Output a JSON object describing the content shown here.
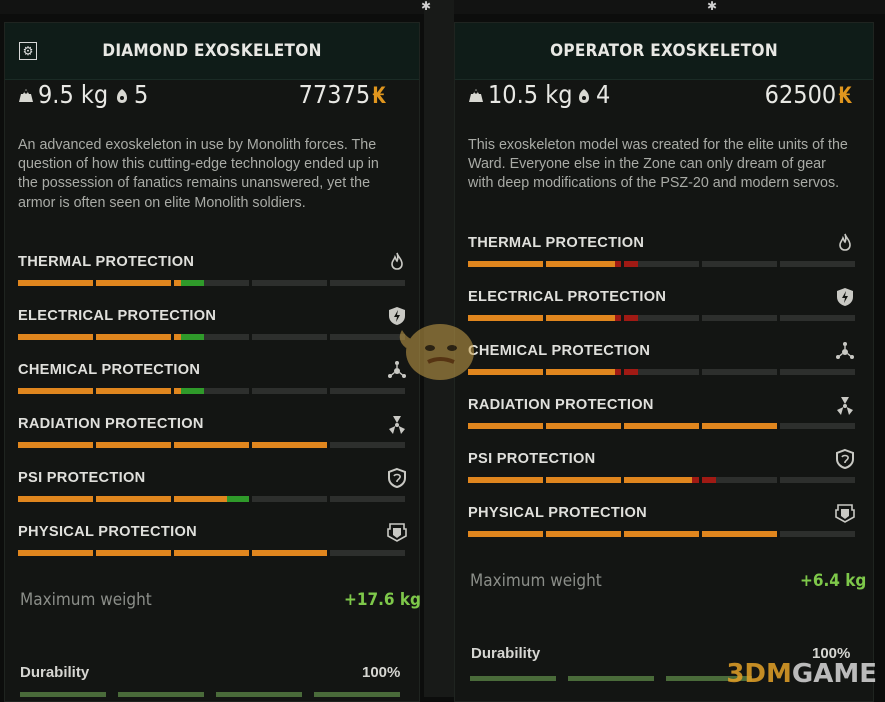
{
  "left": {
    "title": "DIAMOND EXOSKELETON",
    "weight": "9.5 kg",
    "slots": "5",
    "price": "77375",
    "currency": "₭",
    "description": "An advanced exoskeleton in use by Monolith forces. The question of how this cutting-edge technology ended up in the possession of fanatics remains unanswered, yet the armor is often seen on elite Monolith soldiers.",
    "protections": [
      {
        "label": "THERMAL PROTECTION",
        "icon": "fire-icon",
        "value": 0.48,
        "delta_color": "green"
      },
      {
        "label": "ELECTRICAL PROTECTION",
        "icon": "lightning-shield-icon",
        "value": 0.48,
        "delta_color": "green"
      },
      {
        "label": "CHEMICAL PROTECTION",
        "icon": "chemical-icon",
        "value": 0.48,
        "delta_color": "green"
      },
      {
        "label": "RADIATION PROTECTION",
        "icon": "radiation-icon",
        "value": 0.8,
        "delta_color": "none"
      },
      {
        "label": "PSI PROTECTION",
        "icon": "psi-shield-icon",
        "value": 0.6,
        "delta_color": "green"
      },
      {
        "label": "PHYSICAL PROTECTION",
        "icon": "armor-icon",
        "value": 0.8,
        "delta_color": "none"
      }
    ],
    "max_weight_label": "Maximum weight",
    "max_weight_value": "+17.6 kg",
    "durability_label": "Durability",
    "durability_value": "100%"
  },
  "right": {
    "title": "OPERATOR EXOSKELETON",
    "weight": "10.5 kg",
    "slots": "4",
    "price": "62500",
    "currency": "₭",
    "description": "This exoskeleton model was created for the elite units of the Ward.  Everyone else in the Zone can only dream of gear with deep modifications of the PSZ-20 and modern servos.",
    "protections": [
      {
        "label": "THERMAL PROTECTION",
        "icon": "fire-icon",
        "value": 0.38,
        "delta_color": "red"
      },
      {
        "label": "ELECTRICAL PROTECTION",
        "icon": "lightning-shield-icon",
        "value": 0.38,
        "delta_color": "red"
      },
      {
        "label": "CHEMICAL PROTECTION",
        "icon": "chemical-icon",
        "value": 0.38,
        "delta_color": "red"
      },
      {
        "label": "RADIATION PROTECTION",
        "icon": "radiation-icon",
        "value": 0.8,
        "delta_color": "none"
      },
      {
        "label": "PSI PROTECTION",
        "icon": "psi-shield-icon",
        "value": 0.58,
        "delta_color": "red"
      },
      {
        "label": "PHYSICAL PROTECTION",
        "icon": "armor-icon",
        "value": 0.8,
        "delta_color": "none"
      }
    ],
    "max_weight_label": "Maximum weight",
    "max_weight_value": "+6.4 kg",
    "durability_label": "Durability",
    "durability_value": "100%"
  },
  "colors": {
    "bar_fill": "#e0861e",
    "bar_empty": "#2d2f2d",
    "better": "#2f9a2a",
    "worse": "#a01a14",
    "positive_value": "#7ec84a",
    "currency": "#e0961e"
  },
  "watermark": {
    "text_a": "3DM",
    "text_b": "GAME"
  }
}
